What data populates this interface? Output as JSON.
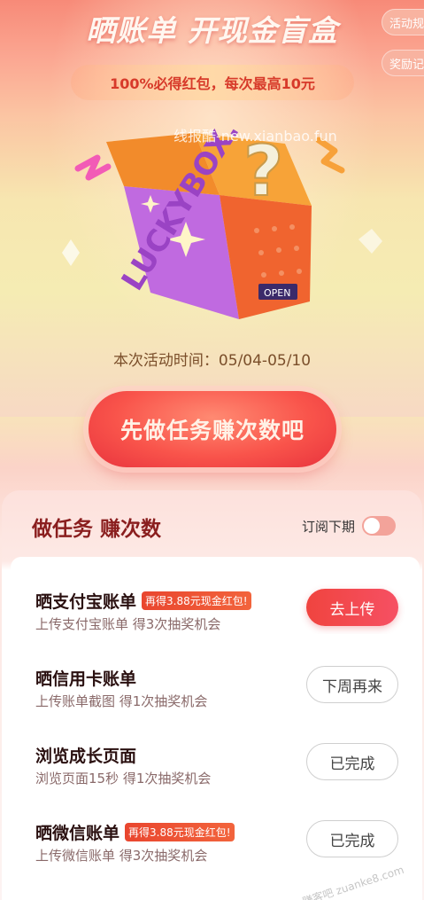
{
  "header": {
    "title": "晒账单 开现金盲盒",
    "subtitle": "100%必得红包，每次最高10元",
    "rules_label": "活动规",
    "prize_label": "奖励记"
  },
  "watermark": "线报酷-new.xianbao.fun",
  "box": {
    "brand_text": "LUCKYBOX.",
    "open_text": "OPEN"
  },
  "activity_time": "本次活动时间：05/04-05/10",
  "cta_label": "先做任务赚次数吧",
  "panel": {
    "title": "做任务 赚次数",
    "subscribe_label": "订阅下期"
  },
  "tasks": [
    {
      "title": "晒支付宝账单",
      "badge": "再得3.88元现金红包!",
      "desc": "上传支付宝账单 得3次抽奖机会",
      "button": "去上传"
    },
    {
      "title": "晒信用卡账单",
      "badge": "",
      "desc": "上传账单截图 得1次抽奖机会",
      "button": "下周再来"
    },
    {
      "title": "浏览成长页面",
      "badge": "",
      "desc": "浏览页面15秒 得1次抽奖机会",
      "button": "已完成"
    },
    {
      "title": "晒微信账单",
      "badge": "再得3.88元现金红包!",
      "desc": "上传微信账单 得3次抽奖机会",
      "button": "已完成"
    }
  ],
  "bottom_watermark": "赚客吧 zuanke8.com",
  "colors": {
    "primary": "#f0443f",
    "title_red": "#8a1e1e",
    "accent_orange": "#f7931e",
    "purple": "#b25ad8"
  }
}
